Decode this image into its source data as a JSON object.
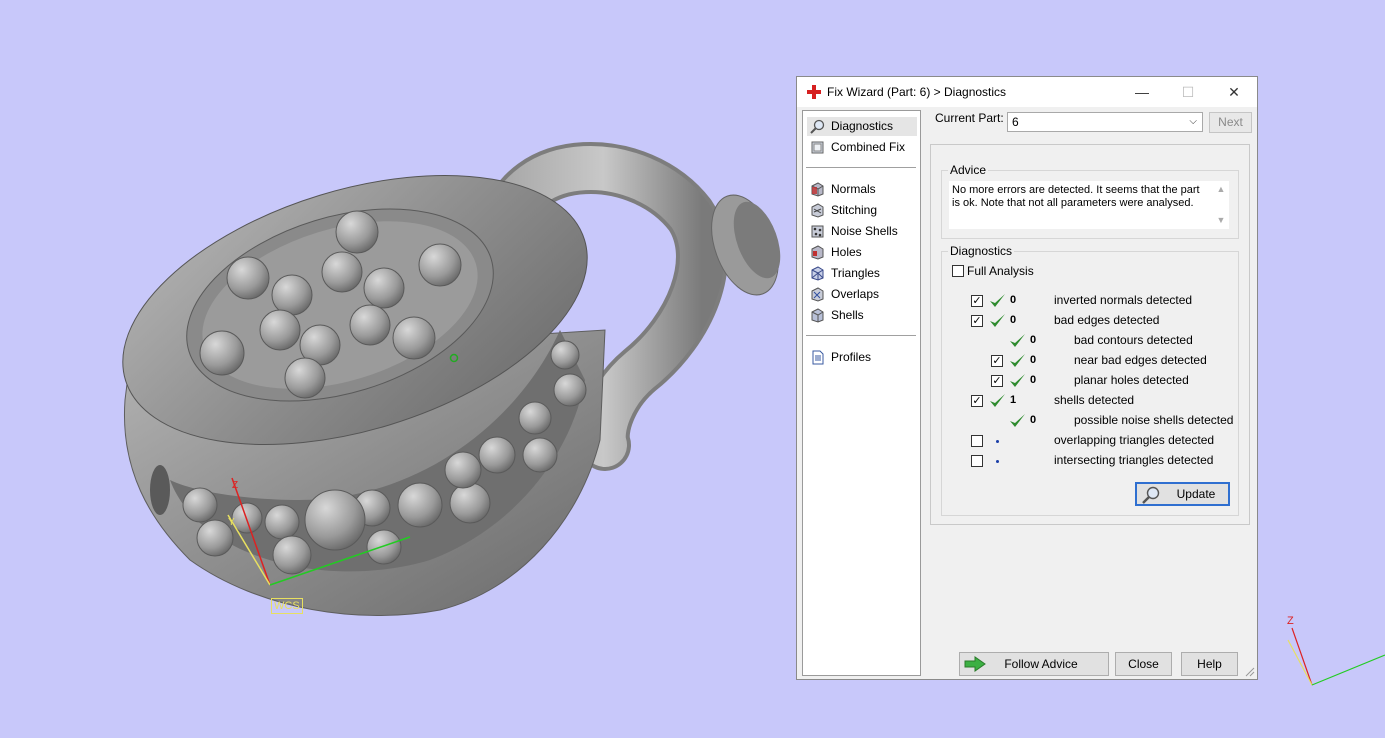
{
  "viewport": {
    "wcs_label": "WCS",
    "axis_labels": {
      "x": "X",
      "y": "Y",
      "z": "Z"
    }
  },
  "dialog": {
    "title": "Fix Wizard (Part: 6) > Diagnostics",
    "window_controls": {
      "minimize": "—",
      "maximize": "☐",
      "close": "✕"
    },
    "nav": {
      "groups": [
        [
          {
            "label": "Diagnostics",
            "icon": "magnifier-icon",
            "selected": true
          },
          {
            "label": "Combined Fix",
            "icon": "combined-fix-icon"
          }
        ],
        [
          {
            "label": "Normals",
            "icon": "normals-icon"
          },
          {
            "label": "Stitching",
            "icon": "stitching-icon"
          },
          {
            "label": "Noise Shells",
            "icon": "noise-shells-icon"
          },
          {
            "label": "Holes",
            "icon": "holes-icon"
          },
          {
            "label": "Triangles",
            "icon": "triangles-icon"
          },
          {
            "label": "Overlaps",
            "icon": "overlaps-icon"
          },
          {
            "label": "Shells",
            "icon": "shells-icon"
          }
        ],
        [
          {
            "label": "Profiles",
            "icon": "profiles-icon"
          }
        ]
      ]
    },
    "current_part": {
      "label": "Current Part:",
      "value": "6",
      "next_label": "Next"
    },
    "advice": {
      "title": "Advice",
      "text": "No more errors are detected. It seems that the part is ok. Note that not all parameters were analysed."
    },
    "diagnostics": {
      "title": "Diagnostics",
      "full_analysis_label": "Full Analysis",
      "full_analysis_checked": false,
      "rows": [
        {
          "checkbox": true,
          "checked": true,
          "status": "ok",
          "count": "0",
          "label": "inverted normals detected",
          "indent": 0
        },
        {
          "checkbox": true,
          "checked": true,
          "status": "ok",
          "count": "0",
          "label": "bad edges detected",
          "indent": 0
        },
        {
          "checkbox": false,
          "checked": false,
          "status": "ok",
          "count": "0",
          "label": "bad contours detected",
          "indent": 1
        },
        {
          "checkbox": true,
          "checked": true,
          "status": "ok",
          "count": "0",
          "label": "near bad edges detected",
          "indent": 1
        },
        {
          "checkbox": true,
          "checked": true,
          "status": "ok",
          "count": "0",
          "label": "planar holes detected",
          "indent": 1
        },
        {
          "checkbox": true,
          "checked": true,
          "status": "ok",
          "count": "1",
          "label": "shells detected",
          "indent": 0
        },
        {
          "checkbox": false,
          "checked": false,
          "status": "ok",
          "count": "0",
          "label": "possible noise shells detected",
          "indent": 1
        },
        {
          "checkbox": true,
          "checked": false,
          "status": "pending",
          "count": "",
          "label": "overlapping triangles detected",
          "indent": 0
        },
        {
          "checkbox": true,
          "checked": false,
          "status": "pending",
          "count": "",
          "label": "intersecting triangles detected",
          "indent": 0
        }
      ],
      "update_label": "Update"
    },
    "footer": {
      "follow_advice_label": "Follow Advice",
      "close_label": "Close",
      "help_label": "Help"
    },
    "colors": {
      "accent": "#2f6fd0",
      "check_green": "#2e8b2e",
      "title_icon_red": "#d62020"
    }
  }
}
